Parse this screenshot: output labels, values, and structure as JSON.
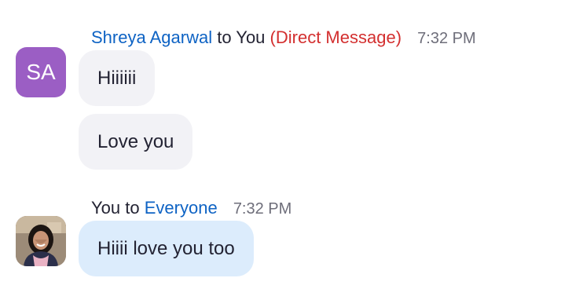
{
  "messages": [
    {
      "sender": "Shreya Agarwal",
      "connector": "to",
      "recipient": "You",
      "tag": "(Direct Message)",
      "time": "7:32 PM",
      "avatar_initials": "SA",
      "bubbles": [
        "Hiiiiii",
        "Love you"
      ]
    },
    {
      "sender": "You",
      "connector": "to",
      "recipient": "Everyone",
      "time": "7:32 PM",
      "bubbles": [
        "Hiiii love you too"
      ]
    }
  ],
  "colors": {
    "avatar_purple": "#9b5ec4",
    "name_blue": "#0e63c4",
    "direct_message_red": "#d32f2f",
    "received_bubble": "#f2f2f6",
    "sent_bubble": "#dcecfc"
  },
  "icons": {
    "avatar_photo": "user-photo-icon"
  }
}
